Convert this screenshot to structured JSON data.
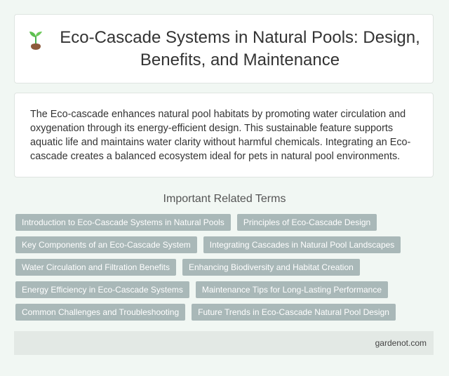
{
  "header": {
    "icon": "sprout-icon",
    "title": "Eco-Cascade Systems in Natural Pools: Design, Benefits, and Maintenance"
  },
  "intro": {
    "text": "The Eco-cascade enhances natural pool habitats by promoting water circulation and oxygenation through its energy-efficient design. This sustainable feature supports aquatic life and maintains water clarity without harmful chemicals. Integrating an Eco-cascade creates a balanced ecosystem ideal for pets in natural pool environments."
  },
  "related": {
    "heading": "Important Related Terms",
    "terms": [
      "Introduction to Eco-Cascade Systems in Natural Pools",
      "Principles of Eco-Cascade Design",
      "Key Components of an Eco-Cascade System",
      "Integrating Cascades in Natural Pool Landscapes",
      "Water Circulation and Filtration Benefits",
      "Enhancing Biodiversity and Habitat Creation",
      "Energy Efficiency in Eco-Cascade Systems",
      "Maintenance Tips for Long-Lasting Performance",
      "Common Challenges and Troubleshooting",
      "Future Trends in Eco-Cascade Natural Pool Design"
    ]
  },
  "footer": {
    "site": "gardenot.com"
  },
  "colors": {
    "background": "#f1f7f3",
    "tag": "#a9b8b8",
    "footer": "#e3e9e5"
  }
}
